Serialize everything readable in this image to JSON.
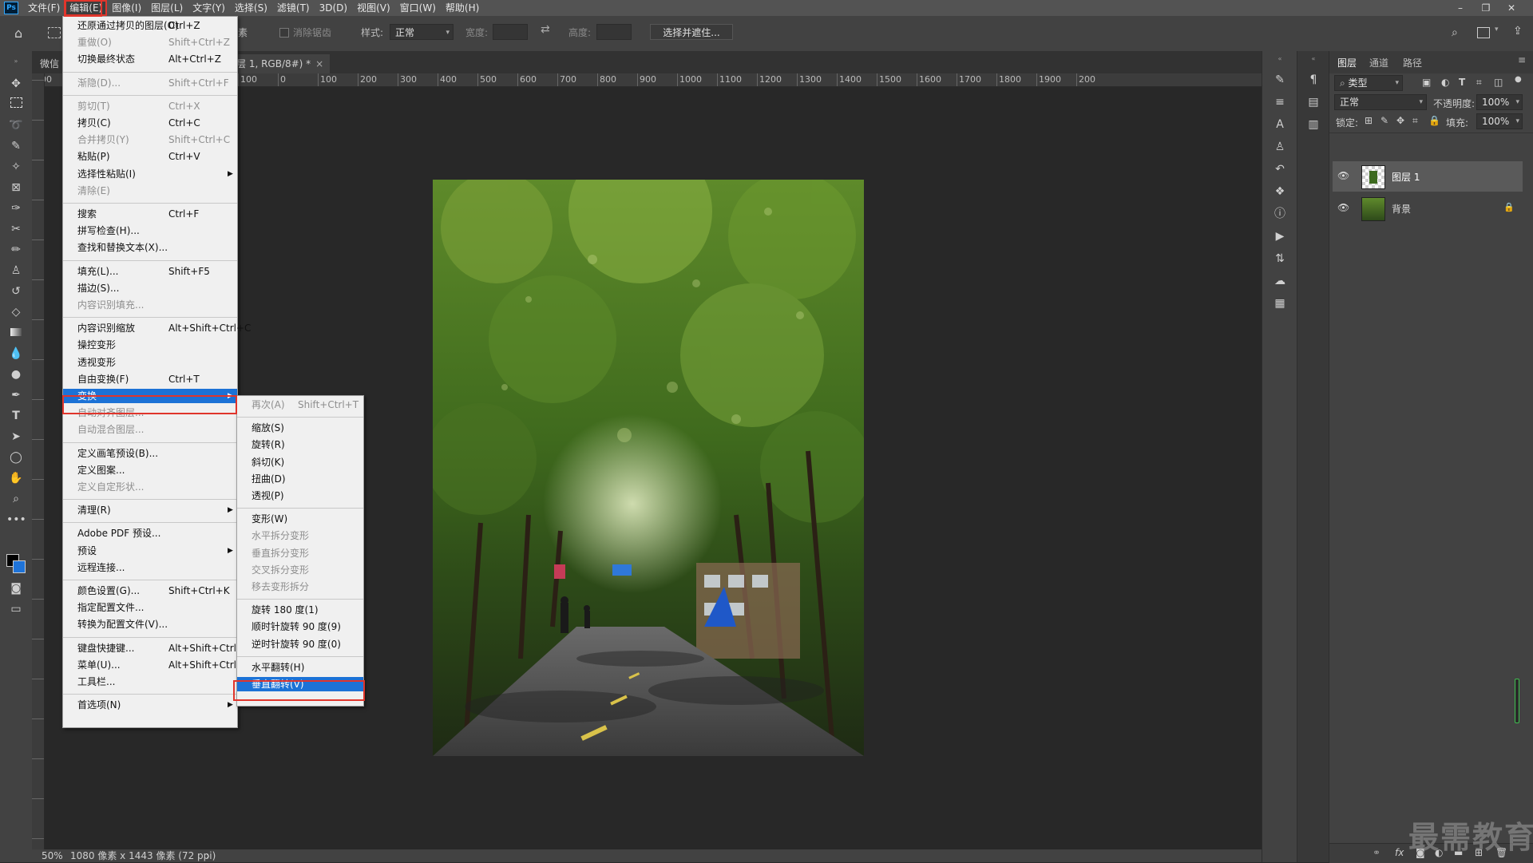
{
  "app": {
    "logo": "Ps"
  },
  "menubar": {
    "items": [
      "文件(F)",
      "编辑(E)",
      "图像(I)",
      "图层(L)",
      "文字(Y)",
      "选择(S)",
      "滤镜(T)",
      "3D(D)",
      "视图(V)",
      "窗口(W)",
      "帮助(H)"
    ],
    "active_index": 1
  },
  "window_controls": {
    "minimize": "–",
    "restore": "❐",
    "close": "✕"
  },
  "options_bar": {
    "partial_label": "素",
    "antialias": "消除锯齿",
    "style_label": "样式:",
    "style_value": "正常",
    "width_label": "宽度:",
    "height_label": "高度:",
    "select_mask": "选择并遮住..."
  },
  "document": {
    "tab_left": "微信",
    "tab_active": "层 1, RGB/8#) *",
    "tab_close": "×"
  },
  "ruler": {
    "h_ticks": [
      "00",
      "500",
      "400",
      "300",
      "200",
      "100",
      "0",
      "100",
      "200",
      "300",
      "400",
      "500",
      "600",
      "700",
      "800",
      "900",
      "1000",
      "1100",
      "1200",
      "1300",
      "1400",
      "1500",
      "1600",
      "1700",
      "1800",
      "1900",
      "200"
    ]
  },
  "status": {
    "zoom": "50%",
    "info": "1080 像素 x 1443 像素 (72 ppi)",
    "arrow": "›"
  },
  "edit_menu": {
    "items": [
      {
        "label": "还原通过拷贝的图层(O)",
        "shortcut": "Ctrl+Z",
        "disabled": false
      },
      {
        "label": "重做(O)",
        "shortcut": "Shift+Ctrl+Z",
        "disabled": true
      },
      {
        "label": "切换最终状态",
        "shortcut": "Alt+Ctrl+Z",
        "disabled": false
      },
      {
        "sep": true
      },
      {
        "label": "渐隐(D)...",
        "shortcut": "Shift+Ctrl+F",
        "disabled": true
      },
      {
        "sep": true
      },
      {
        "label": "剪切(T)",
        "shortcut": "Ctrl+X",
        "disabled": true
      },
      {
        "label": "拷贝(C)",
        "shortcut": "Ctrl+C",
        "disabled": false
      },
      {
        "label": "合并拷贝(Y)",
        "shortcut": "Shift+Ctrl+C",
        "disabled": true
      },
      {
        "label": "粘贴(P)",
        "shortcut": "Ctrl+V",
        "disabled": false
      },
      {
        "label": "选择性粘贴(I)",
        "shortcut": "",
        "disabled": false,
        "submenu": true
      },
      {
        "label": "清除(E)",
        "shortcut": "",
        "disabled": true
      },
      {
        "sep": true
      },
      {
        "label": "搜索",
        "shortcut": "Ctrl+F",
        "disabled": false
      },
      {
        "label": "拼写检查(H)...",
        "shortcut": "",
        "disabled": false
      },
      {
        "label": "查找和替换文本(X)...",
        "shortcut": "",
        "disabled": false
      },
      {
        "sep": true
      },
      {
        "label": "填充(L)...",
        "shortcut": "Shift+F5",
        "disabled": false
      },
      {
        "label": "描边(S)...",
        "shortcut": "",
        "disabled": false
      },
      {
        "label": "内容识别填充...",
        "shortcut": "",
        "disabled": true
      },
      {
        "sep": true
      },
      {
        "label": "内容识别缩放",
        "shortcut": "Alt+Shift+Ctrl+C",
        "disabled": false
      },
      {
        "label": "操控变形",
        "shortcut": "",
        "disabled": false
      },
      {
        "label": "透视变形",
        "shortcut": "",
        "disabled": false
      },
      {
        "label": "自由变换(F)",
        "shortcut": "Ctrl+T",
        "disabled": false
      },
      {
        "label": "变换",
        "shortcut": "",
        "disabled": false,
        "submenu": true,
        "highlighted": true
      },
      {
        "label": "自动对齐图层...",
        "shortcut": "",
        "disabled": true
      },
      {
        "label": "自动混合图层...",
        "shortcut": "",
        "disabled": true
      },
      {
        "sep": true
      },
      {
        "label": "定义画笔预设(B)...",
        "shortcut": "",
        "disabled": false
      },
      {
        "label": "定义图案...",
        "shortcut": "",
        "disabled": false
      },
      {
        "label": "定义自定形状...",
        "shortcut": "",
        "disabled": true
      },
      {
        "sep": true
      },
      {
        "label": "清理(R)",
        "shortcut": "",
        "disabled": false,
        "submenu": true
      },
      {
        "sep": true
      },
      {
        "label": "Adobe PDF 预设...",
        "shortcut": "",
        "disabled": false
      },
      {
        "label": "预设",
        "shortcut": "",
        "disabled": false,
        "submenu": true
      },
      {
        "label": "远程连接...",
        "shortcut": "",
        "disabled": false
      },
      {
        "sep": true
      },
      {
        "label": "颜色设置(G)...",
        "shortcut": "Shift+Ctrl+K",
        "disabled": false
      },
      {
        "label": "指定配置文件...",
        "shortcut": "",
        "disabled": false
      },
      {
        "label": "转换为配置文件(V)...",
        "shortcut": "",
        "disabled": false
      },
      {
        "sep": true
      },
      {
        "label": "键盘快捷键...",
        "shortcut": "Alt+Shift+Ctrl+K",
        "disabled": false
      },
      {
        "label": "菜单(U)...",
        "shortcut": "Alt+Shift+Ctrl+M",
        "disabled": false
      },
      {
        "label": "工具栏...",
        "shortcut": "",
        "disabled": false
      },
      {
        "sep": true
      },
      {
        "label": "首选项(N)",
        "shortcut": "",
        "disabled": false,
        "submenu": true
      }
    ]
  },
  "transform_submenu": {
    "items": [
      {
        "label": "再次(A)",
        "shortcut": "Shift+Ctrl+T",
        "disabled": true
      },
      {
        "sep": true
      },
      {
        "label": "缩放(S)",
        "shortcut": "",
        "disabled": false
      },
      {
        "label": "旋转(R)",
        "shortcut": "",
        "disabled": false
      },
      {
        "label": "斜切(K)",
        "shortcut": "",
        "disabled": false
      },
      {
        "label": "扭曲(D)",
        "shortcut": "",
        "disabled": false
      },
      {
        "label": "透视(P)",
        "shortcut": "",
        "disabled": false
      },
      {
        "sep": true
      },
      {
        "label": "变形(W)",
        "shortcut": "",
        "disabled": false
      },
      {
        "label": "水平拆分变形",
        "shortcut": "",
        "disabled": true
      },
      {
        "label": "垂直拆分变形",
        "shortcut": "",
        "disabled": true
      },
      {
        "label": "交叉拆分变形",
        "shortcut": "",
        "disabled": true
      },
      {
        "label": "移去变形拆分",
        "shortcut": "",
        "disabled": true
      },
      {
        "sep": true
      },
      {
        "label": "旋转 180 度(1)",
        "shortcut": "",
        "disabled": false
      },
      {
        "label": "顺时针旋转 90 度(9)",
        "shortcut": "",
        "disabled": false
      },
      {
        "label": "逆时针旋转 90 度(0)",
        "shortcut": "",
        "disabled": false
      },
      {
        "sep": true
      },
      {
        "label": "水平翻转(H)",
        "shortcut": "",
        "disabled": false
      },
      {
        "label": "垂直翻转(V)",
        "shortcut": "",
        "disabled": false,
        "highlighted": true
      }
    ]
  },
  "layers_panel": {
    "tabs": [
      "图层",
      "通道",
      "路径"
    ],
    "filter_label": "类型",
    "blend_mode": "正常",
    "opacity_label": "不透明度:",
    "opacity_value": "100%",
    "lock_label": "锁定:",
    "fill_label": "填充:",
    "fill_value": "100%",
    "layers": [
      {
        "name": "图层 1",
        "selected": true,
        "locked": false
      },
      {
        "name": "背景",
        "selected": false,
        "locked": true
      }
    ],
    "footer_icons": [
      "link-icon",
      "fx-icon",
      "mask-icon",
      "adjustment-icon",
      "group-icon",
      "new-layer-icon",
      "delete-icon"
    ]
  },
  "watermark": "最需教育",
  "colors": {
    "menu_highlight": "#1c72d6",
    "annotation_red": "#e0352c",
    "panel_bg": "#424242"
  }
}
